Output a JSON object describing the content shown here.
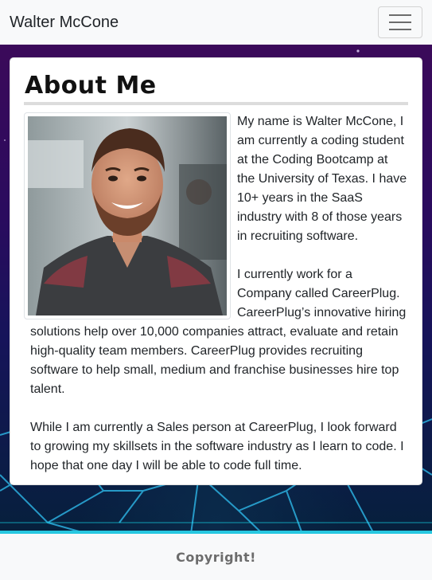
{
  "navbar": {
    "brand": "Walter McCone",
    "toggle_icon": "hamburger-icon"
  },
  "about": {
    "title": "About Me",
    "photo_icon": "profile-photo",
    "paragraphs": [
      "My name is Walter McCone, I am currently a coding student at the Coding Bootcamp at the University of Texas. I have 10+ years in the SaaS industry with 8 of those years in recruiting software.",
      "I currently work for a Company called CareerPlug. CareerPlug’s innovative hiring solutions help over 10,000 companies attract, evaluate and retain high-quality team members. CareerPlug provides recruiting software to help small, medium and franchise businesses hire top talent.",
      "While I am currently a Sales person at CareerPlug, I look forward to growing my skillsets in the software industry as I learn to code. I hope that one day I will be able to code full time."
    ]
  },
  "footer": {
    "text": "Copyright!"
  },
  "colors": {
    "navbar_bg": "#f8f9fa",
    "accent_cyan": "#27c7e0",
    "background_purple": "#2a0b5e"
  }
}
